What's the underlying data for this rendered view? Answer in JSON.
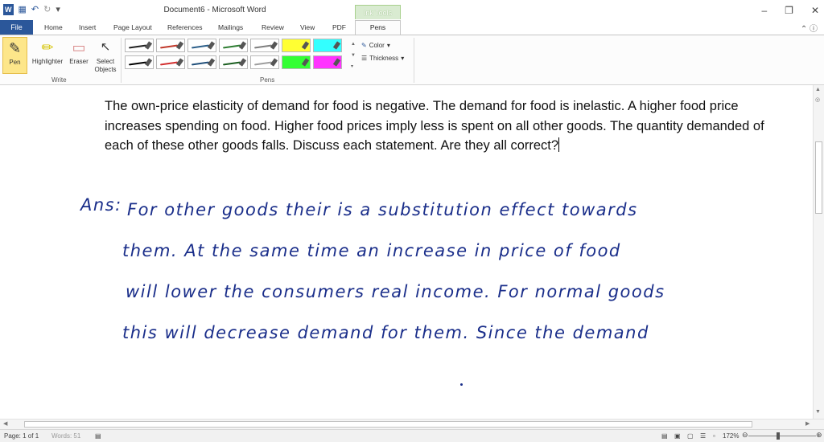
{
  "title_bar": {
    "title": "Document6 - Microsoft Word",
    "context_group": "Ink Tools",
    "quick_access": [
      "word-logo-icon",
      "save-icon",
      "undo-icon",
      "redo-icon",
      "customize-icon"
    ],
    "window_controls": [
      "minimize-icon",
      "restore-icon",
      "close-icon"
    ]
  },
  "tabs": [
    "File",
    "Home",
    "Insert",
    "Page Layout",
    "References",
    "Mailings",
    "Review",
    "View",
    "PDF",
    "Pens"
  ],
  "ribbon": {
    "write_group": {
      "label": "Write",
      "buttons": [
        {
          "label": "Pen",
          "icon": "pen-icon"
        },
        {
          "label": "Highlighter",
          "icon": "highlighter-icon"
        },
        {
          "label": "Eraser",
          "icon": "eraser-icon"
        },
        {
          "label": "Select Objects",
          "icon": "cursor-icon"
        }
      ]
    },
    "pens_group": {
      "label": "Pens",
      "color_label": "Color",
      "thickness_label": "Thickness",
      "swatches": [
        {
          "color": "#222222",
          "kind": "pen"
        },
        {
          "color": "#c0392b",
          "kind": "pen"
        },
        {
          "color": "#2c5f8a",
          "kind": "pen"
        },
        {
          "color": "#2e7d32",
          "kind": "pen"
        },
        {
          "color": "#7f7f7f",
          "kind": "pen"
        },
        {
          "color": "#ffff33",
          "kind": "highlighter"
        },
        {
          "color": "#33ffff",
          "kind": "highlighter"
        },
        {
          "color": "#000000",
          "kind": "pen"
        },
        {
          "color": "#d32f2f",
          "kind": "pen"
        },
        {
          "color": "#1f4e79",
          "kind": "pen"
        },
        {
          "color": "#1b5e20",
          "kind": "pen"
        },
        {
          "color": "#9e9e9e",
          "kind": "pen"
        },
        {
          "color": "#33ff33",
          "kind": "highlighter"
        },
        {
          "color": "#ff33ff",
          "kind": "highlighter"
        }
      ]
    }
  },
  "document": {
    "typed_text": "The own-price elasticity of demand for food is negative. The demand for food is inelastic. A higher food price increases spending on food. Higher food prices imply less is spent on all other goods. The quantity demanded of each of these other goods falls. Discuss each statement. Are they all correct?",
    "handwriting": [
      "Ans:",
      "For other goods their is  a substitution effect towards",
      "them. At the same time an increase in price of food",
      "will lower the consumers real income. For normal goods",
      "this will decrease demand for them. Since the demand"
    ]
  },
  "status_bar": {
    "page": "Page: 1 of 1",
    "words": "Words: 51",
    "zoom": "172%",
    "zoom_level": 0.44
  }
}
